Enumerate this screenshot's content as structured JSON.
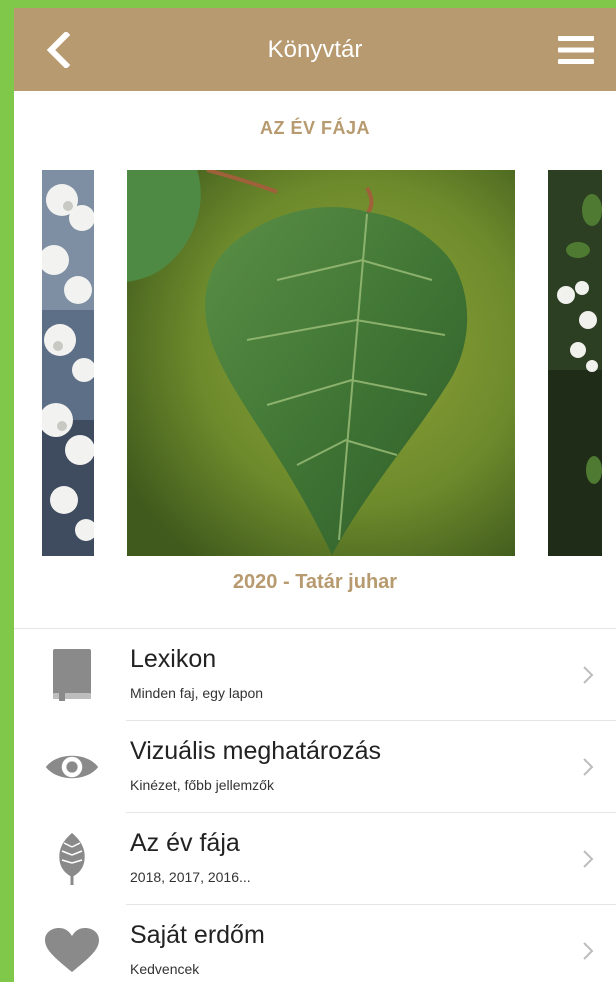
{
  "header": {
    "title": "Könyvtár",
    "back_icon": "chevron-left-icon",
    "menu_icon": "hamburger-menu-icon"
  },
  "featured": {
    "section_title": "AZ ÉV FÁJA",
    "caption": "2020 - Tatár juhar"
  },
  "menu": {
    "items": [
      {
        "title": "Lexikon",
        "subtitle": "Minden faj, egy lapon",
        "icon": "book-icon"
      },
      {
        "title": "Vizuális meghatározás",
        "subtitle": "Kinézet, főbb jellemzők",
        "icon": "eye-icon"
      },
      {
        "title": "Az év fája",
        "subtitle": "2018, 2017, 2016...",
        "icon": "leaf-icon"
      },
      {
        "title": "Saját erdőm",
        "subtitle": "Kedvencek",
        "icon": "heart-icon"
      }
    ]
  },
  "colors": {
    "header_bg": "#b79a6f",
    "accent_text": "#b79a6f",
    "frame_green": "#7fc84a",
    "icon_gray": "#8a8a8a",
    "chevron_gray": "#bdbdbd"
  }
}
